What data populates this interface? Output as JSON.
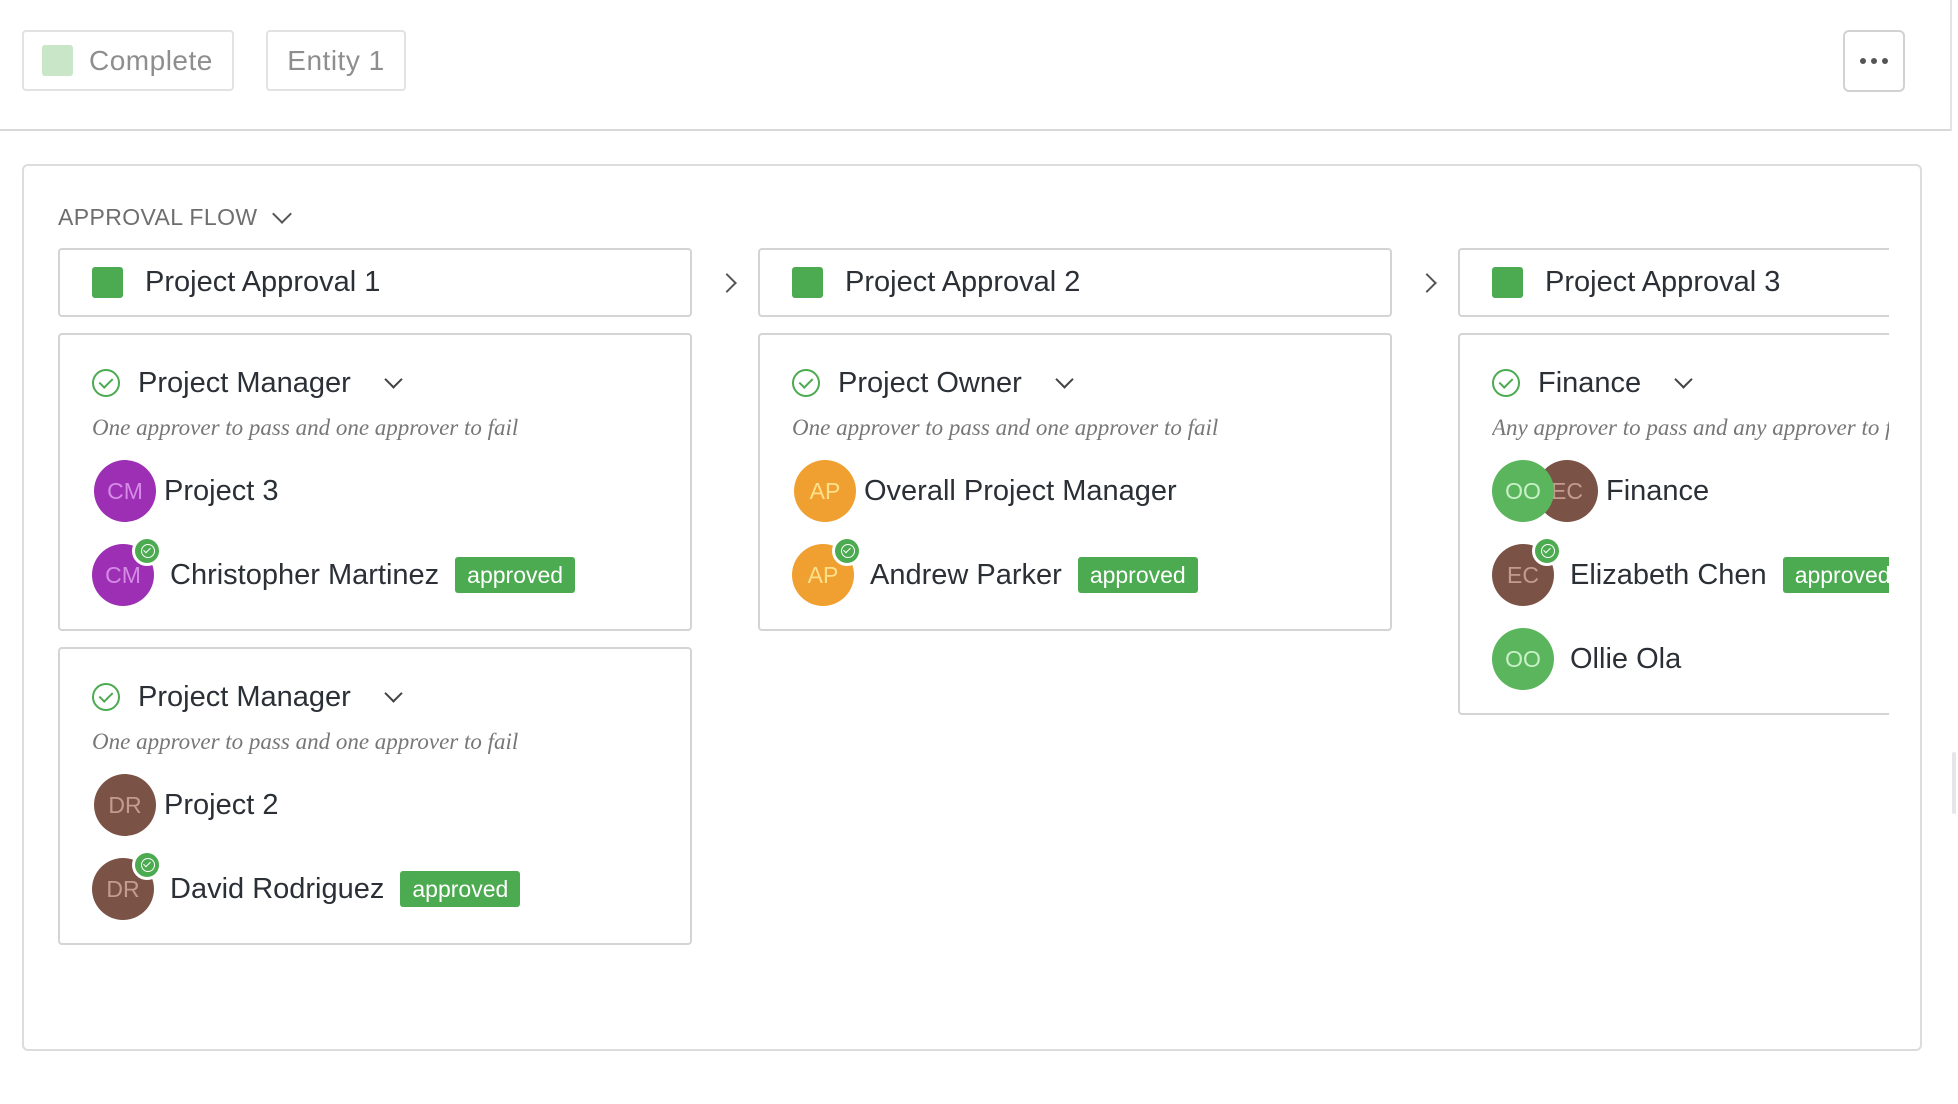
{
  "toolbar": {
    "status_label": "Complete",
    "entity_label": "Entity 1",
    "status_color": "#c9e6c9"
  },
  "approval_flow": {
    "title": "APPROVAL FLOW",
    "stage_color": "#4caa50",
    "approved_color": "#4caa50",
    "stages": [
      {
        "title": "Project Approval 1",
        "groups": [
          {
            "role": "Project Manager",
            "rule": "One approver to pass and one approver to fail",
            "assignee": {
              "initials": "CM",
              "name": "Project 3",
              "color": "purple"
            },
            "approver": {
              "initials": "CM",
              "name": "Christopher Martinez",
              "status": "approved"
            }
          },
          {
            "role": "Project Manager",
            "rule": "One approver to pass and one approver to fail",
            "assignee": {
              "initials": "DR",
              "name": "Project 2",
              "color": "brown"
            },
            "approver": {
              "initials": "DR",
              "name": "David Rodriguez",
              "status": "approved"
            }
          }
        ]
      },
      {
        "title": "Project Approval 2",
        "groups": [
          {
            "role": "Project Owner",
            "rule": "One approver to pass and one approver to fail",
            "assignee": {
              "initials": "AP",
              "name": "Overall Project Manager",
              "color": "orange"
            },
            "approver": {
              "initials": "AP",
              "name": "Andrew Parker",
              "status": "approved"
            }
          }
        ]
      },
      {
        "title": "Project Approval 3",
        "groups": [
          {
            "role": "Finance",
            "rule": "Any approver to pass and any approver to fail",
            "assignee": {
              "initials_1": "OO",
              "initials_2": "EC",
              "name": "Finance"
            },
            "approver": {
              "initials": "EC",
              "name": "Elizabeth Chen",
              "status": "approved"
            },
            "pending": {
              "initials": "OO",
              "name": "Ollie Ola"
            }
          }
        ]
      }
    ]
  }
}
